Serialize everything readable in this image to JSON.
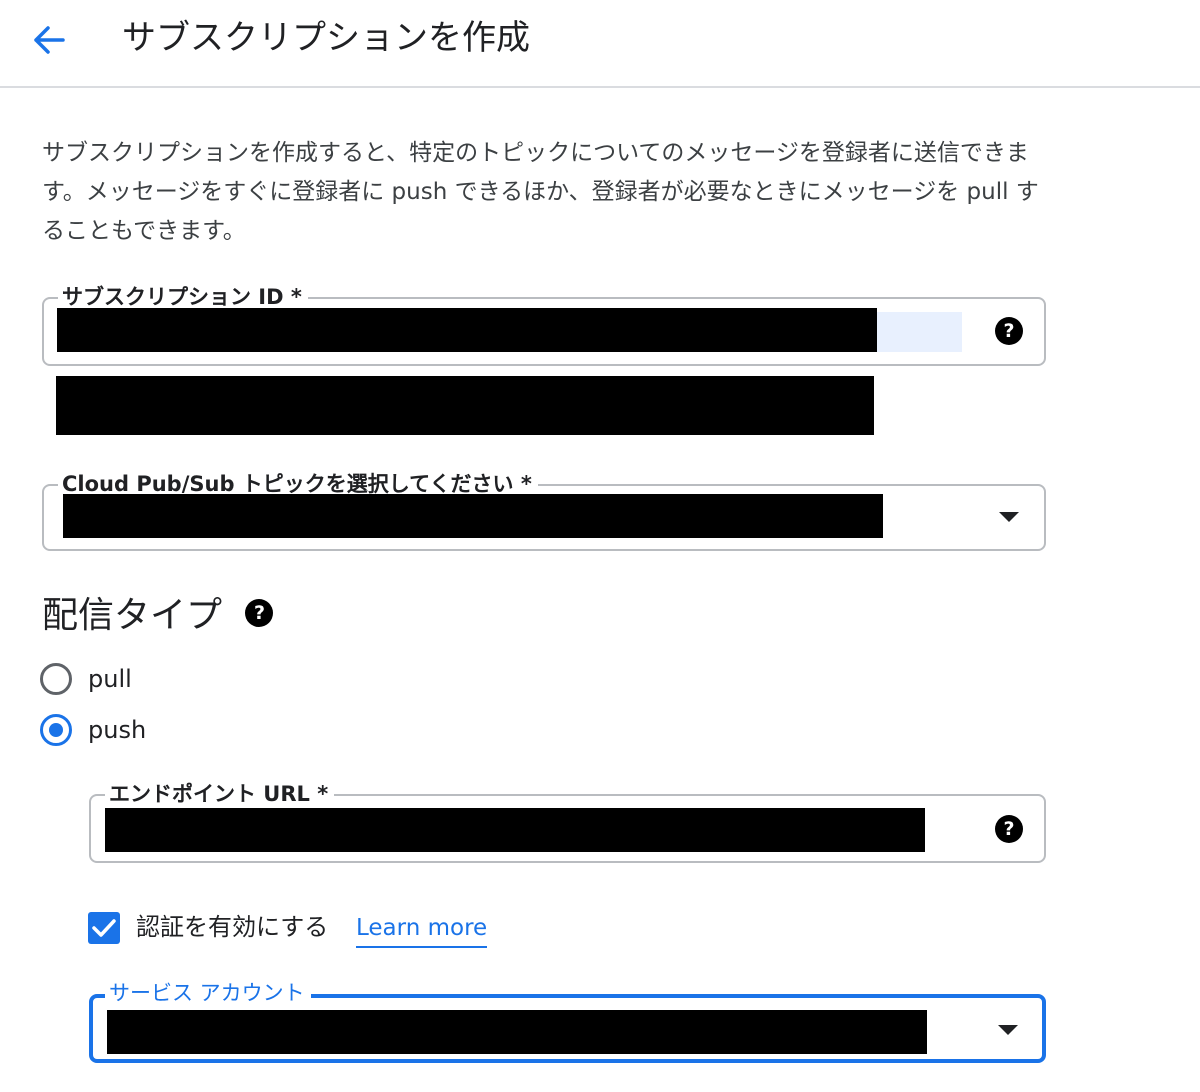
{
  "header": {
    "back_icon": "arrow-left-icon",
    "title": "サブスクリプションを作成"
  },
  "description": "サブスクリプションを作成すると、特定のトピックについてのメッセージを登録者に送信できます。メッセージをすぐに登録者に push できるほか、登録者が必要なときにメッセージを pull することもできます。",
  "subscription_id": {
    "label": "サブスクリプション ID *",
    "value": "[redacted]",
    "help_icon": "help-icon"
  },
  "topic": {
    "label": "Cloud Pub/Sub トピックを選択してください *",
    "value": "[redacted]"
  },
  "delivery": {
    "title": "配信タイプ",
    "options": [
      {
        "label": "pull",
        "checked": false
      },
      {
        "label": "push",
        "checked": true
      }
    ]
  },
  "endpoint": {
    "label": "エンドポイント URL *",
    "value": "[redacted]"
  },
  "auth": {
    "label": "認証を有効にする",
    "checked": true,
    "learn_more": "Learn more"
  },
  "service_account": {
    "label": "サービス アカウント",
    "value": "[redacted]"
  },
  "colors": {
    "accent": "#1a73e8",
    "border": "#b9bcc0",
    "text": "#202124"
  }
}
